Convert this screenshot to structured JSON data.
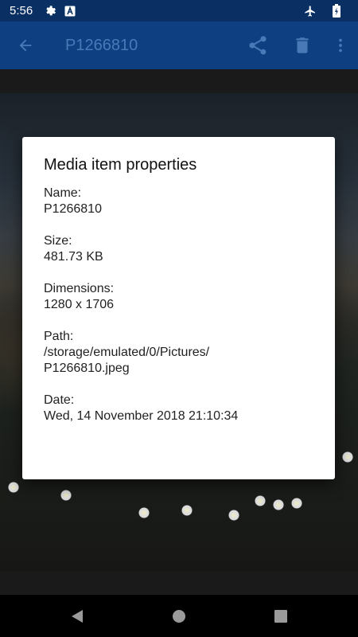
{
  "status_bar": {
    "time": "5:56",
    "icons": [
      "gear-icon",
      "a-badge-icon",
      "airplane-icon",
      "battery-icon"
    ]
  },
  "toolbar": {
    "title": "P1266810",
    "icons": [
      "back-arrow-icon",
      "share-icon",
      "delete-icon",
      "more-vert-icon"
    ]
  },
  "dialog": {
    "title": "Media item properties",
    "properties": [
      {
        "label": "Name:",
        "value_lines": [
          "P1266810"
        ]
      },
      {
        "label": "Size:",
        "value_lines": [
          "481.73 KB"
        ]
      },
      {
        "label": "Dimensions:",
        "value_lines": [
          "1280 x 1706"
        ]
      },
      {
        "label": "Path:",
        "value_lines": [
          "/storage/emulated/0/Pictures/",
          "P1266810.jpeg"
        ]
      },
      {
        "label": "Date:",
        "value_lines": [
          "Wed, 14 November 2018 21:10:34"
        ]
      }
    ]
  },
  "navbar": {
    "icons": [
      "back-triangle-icon",
      "home-circle-icon",
      "recents-square-icon"
    ]
  },
  "colors": {
    "status_bar": "#0a2f63",
    "toolbar": "#0e3f80",
    "toolbar_title": "#4a79b8",
    "dialog_bg": "#ffffff"
  }
}
